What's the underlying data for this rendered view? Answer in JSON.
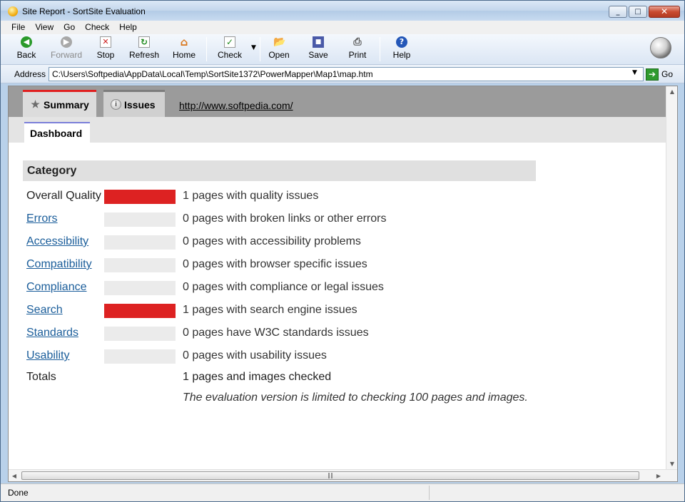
{
  "window": {
    "title": "Site Report - SortSite Evaluation"
  },
  "menu": [
    "File",
    "View",
    "Go",
    "Check",
    "Help"
  ],
  "toolbar": {
    "back": "Back",
    "forward": "Forward",
    "stop": "Stop",
    "refresh": "Refresh",
    "home": "Home",
    "check": "Check",
    "open": "Open",
    "save": "Save",
    "print": "Print",
    "help": "Help"
  },
  "address": {
    "label": "Address",
    "value": "C:\\Users\\Softpedia\\AppData\\Local\\Temp\\SortSite1372\\PowerMapper\\Map1\\map.htm",
    "go": "Go"
  },
  "report": {
    "tabs": {
      "summary": "Summary",
      "issues": "Issues"
    },
    "site_url": "http://www.softpedia.com/",
    "subtab": "Dashboard",
    "category_header": "Category",
    "rows": [
      {
        "label": "Overall Quality",
        "desc": "1 pages with quality issues",
        "level": 1.0
      },
      {
        "label": "Errors",
        "desc": "0 pages with broken links or other errors",
        "level": 0.0
      },
      {
        "label": "Accessibility",
        "desc": "0 pages with accessibility problems",
        "level": 0.0
      },
      {
        "label": "Compatibility",
        "desc": "0 pages with browser specific issues",
        "level": 0.0
      },
      {
        "label": "Compliance",
        "desc": "0 pages with compliance or legal issues",
        "level": 0.0
      },
      {
        "label": "Search",
        "desc": "1 pages with search engine issues",
        "level": 1.0
      },
      {
        "label": "Standards",
        "desc": "0 pages have W3C standards issues",
        "level": 0.0
      },
      {
        "label": "Usability",
        "desc": "0 pages with usability issues",
        "level": 0.0
      }
    ],
    "totals_label": "Totals",
    "totals_desc": "1 pages and images checked",
    "note": "The evaluation version is limited to checking 100 pages and images."
  },
  "status": {
    "text": "Done"
  },
  "colors": {
    "accent_red": "#dd2222",
    "link": "#1a5d9a",
    "tab_summary_border": "#e02020",
    "dashboard_border": "#7b7fd9"
  }
}
